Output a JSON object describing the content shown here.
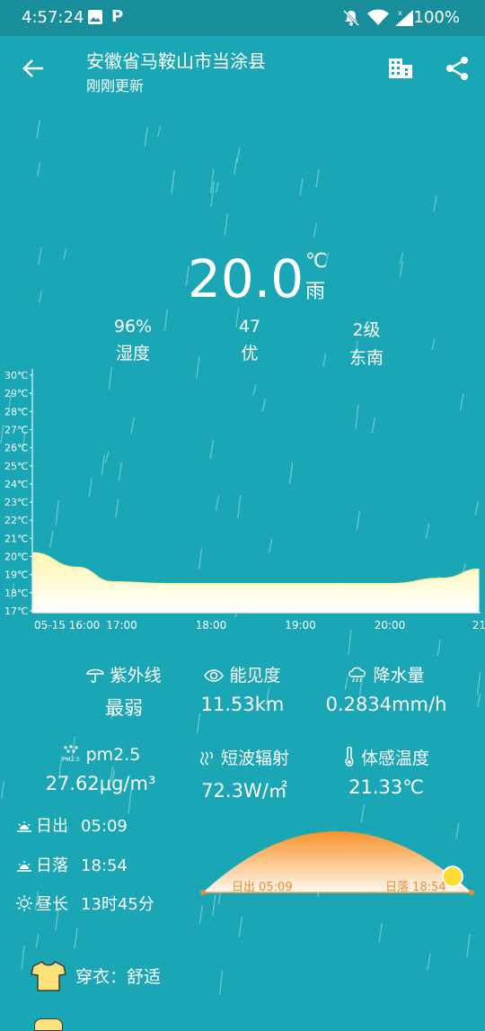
{
  "status": {
    "time": "4:57:24",
    "battery": "100%",
    "p_label": "P"
  },
  "header": {
    "location": "安徽省马鞍山市当涂县",
    "updated": "刚刚更新"
  },
  "current": {
    "temperature": "20.0",
    "unit": "℃",
    "condition": "雨"
  },
  "stats": [
    {
      "value": "96%",
      "label": "湿度"
    },
    {
      "value": "47",
      "label": "优"
    },
    {
      "value": "2级",
      "label": "东南"
    }
  ],
  "chart_data": {
    "type": "area",
    "y_ticks": [
      "30℃",
      "29℃",
      "28℃",
      "27℃",
      "26℃",
      "25℃",
      "24℃",
      "23℃",
      "22℃",
      "21℃",
      "20℃",
      "19℃",
      "18℃",
      "17℃"
    ],
    "x_ticks": [
      "05-15 16:00",
      "17:00",
      "18:00",
      "19:00",
      "20:00",
      "21"
    ],
    "ylim": [
      17,
      30
    ],
    "x": [
      16.0,
      16.5,
      16.9,
      17.5,
      18.0,
      19.0,
      20.0,
      20.6,
      21.0
    ],
    "values": [
      20.2,
      19.4,
      18.6,
      18.5,
      18.5,
      18.5,
      18.5,
      18.8,
      19.3
    ],
    "colors": {
      "top": "#fdf7b0",
      "bottom": "#ffffff"
    }
  },
  "metrics": [
    {
      "icon": "umbrella-icon",
      "label": "紫外线",
      "value": "最弱"
    },
    {
      "icon": "eye-icon",
      "label": "能见度",
      "value": "11.53km"
    },
    {
      "icon": "rain-cloud-icon",
      "label": "降水量",
      "value": "0.2834mm/h"
    },
    {
      "icon": "pm25-icon",
      "label": "pm2.5",
      "value": "27.62μg/m³"
    },
    {
      "icon": "radiation-icon",
      "label": "短波辐射",
      "value": "72.3W/㎡"
    },
    {
      "icon": "thermometer-icon",
      "label": "体感温度",
      "value": "21.33℃"
    }
  ],
  "sun": {
    "sunrise_label": "日出",
    "sunrise": "05:09",
    "sunset_label": "日落",
    "sunset": "18:54",
    "daylength_label": "昼长",
    "daylength": "13时45分",
    "arc_sunrise_text": "日出 05:09",
    "arc_sunset_text": "日落 18:54",
    "sun_progress": 0.93,
    "pm25_badge": "PM2.5"
  },
  "clothing": {
    "label": "穿衣：舒适"
  }
}
